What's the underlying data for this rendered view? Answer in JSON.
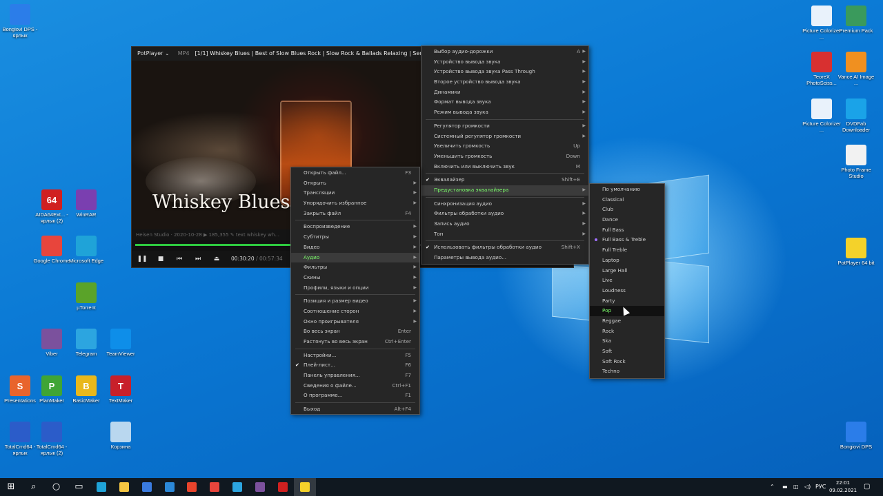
{
  "desktop": {
    "icons": [
      {
        "label": "Bongiovi DPS - ярлык",
        "icon": "bongiovi-icon",
        "color": "#2b7de9"
      },
      {
        "label": "AIDA64Ext... - ярлык (2)",
        "icon": "aida64-icon",
        "glyph": "64",
        "color": "#d02020"
      },
      {
        "label": "WinRAR",
        "icon": "winrar-icon",
        "color": "#7a3fb0"
      },
      {
        "label": "Google Chrome",
        "icon": "chrome-icon",
        "color": "#e8453c"
      },
      {
        "label": "Microsoft Edge",
        "icon": "edge-icon",
        "color": "#1fa3d8"
      },
      {
        "label": "µTorrent",
        "icon": "utorrent-icon",
        "color": "#5aa329"
      },
      {
        "label": "Viber",
        "icon": "viber-icon",
        "color": "#7b519d"
      },
      {
        "label": "Telegram",
        "icon": "telegram-icon",
        "color": "#2ca5e0"
      },
      {
        "label": "TeamViewer",
        "icon": "teamviewer-icon",
        "color": "#0e8ee9"
      },
      {
        "label": "Presentations",
        "icon": "presentations-icon",
        "glyph": "S",
        "color": "#e8642c"
      },
      {
        "label": "PlanMaker",
        "icon": "planmaker-icon",
        "glyph": "P",
        "color": "#3fa535"
      },
      {
        "label": "BasicMaker",
        "icon": "basicmaker-icon",
        "glyph": "B",
        "color": "#e9b81b"
      },
      {
        "label": "TextMaker",
        "icon": "textmaker-icon",
        "glyph": "T",
        "color": "#c8202a"
      },
      {
        "label": "TotalCmd64 - ярлык",
        "icon": "totalcmd-icon",
        "color": "#2b5cc9"
      },
      {
        "label": "TotalCmd64 - ярлык (2)",
        "icon": "totalcmd-icon",
        "color": "#2b5cc9"
      },
      {
        "label": "Корзина",
        "icon": "recycle-bin-icon",
        "color": "#b9d7ef"
      },
      {
        "label": "Picture Colorizer ...",
        "icon": "picture-colorizer-icon",
        "color": "#e9f2fb"
      },
      {
        "label": "Premium Pack",
        "icon": "premium-pack-icon",
        "color": "#3a9a5c"
      },
      {
        "label": "TeoreX PhotoSciss...",
        "icon": "photoscissors-icon",
        "color": "#d83030"
      },
      {
        "label": "Vance AI Image ...",
        "icon": "vanceai-icon",
        "color": "#f09020"
      },
      {
        "label": "Picture Colorizer ...",
        "icon": "picture-colorizer-icon",
        "color": "#e9f2fb"
      },
      {
        "label": "DVDFab Downloader",
        "icon": "dvdfab-icon",
        "color": "#1aa3e8"
      },
      {
        "label": "Photo Frame Studio",
        "icon": "photo-frame-icon",
        "color": "#f2f2f2"
      },
      {
        "label": "PotPlayer 64 bit",
        "icon": "potplayer-icon",
        "color": "#f4d22a"
      },
      {
        "label": "Bongiovi DPS",
        "icon": "bongiovi-icon",
        "color": "#2b7de9"
      }
    ]
  },
  "player": {
    "app_name": "PotPlayer ⌄",
    "format": "MP4",
    "title": "[1/1] Whiskey Blues | Best of Slow Blues Rock | Slow Rock & Ballads Relaxing | Sensu",
    "video_title_text": "Whiskey Blues",
    "meta_text": "Heisen Studio  ·  2020-10-28  ▶ 185,355  ✎ text whiskey wh...",
    "current_time": "00:30:20",
    "duration": "/ 00:57:34",
    "progress": 0.53
  },
  "context_menu": {
    "items": [
      {
        "label": "Открыть файл...",
        "shortcut": "F3"
      },
      {
        "label": "Открыть",
        "arrow": true
      },
      {
        "label": "Трансляции",
        "arrow": true
      },
      {
        "label": "Упорядочить избранное",
        "arrow": true
      },
      {
        "label": "Закрыть файл",
        "shortcut": "F4"
      },
      {
        "sep": true
      },
      {
        "label": "Воспроизведение",
        "arrow": true
      },
      {
        "label": "Субтитры",
        "arrow": true
      },
      {
        "label": "Видео",
        "arrow": true
      },
      {
        "label": "Аудио",
        "arrow": true,
        "highlight": true
      },
      {
        "label": "Фильтры",
        "arrow": true
      },
      {
        "label": "Скины",
        "arrow": true
      },
      {
        "label": "Профили, языки и опции",
        "arrow": true
      },
      {
        "sep": true
      },
      {
        "label": "Позиция и размер видео",
        "arrow": true
      },
      {
        "label": "Соотношение сторон",
        "arrow": true
      },
      {
        "label": "Окно проигрывателя",
        "arrow": true
      },
      {
        "label": "Во весь экран",
        "shortcut": "Enter"
      },
      {
        "label": "Растянуть во весь экран",
        "shortcut": "Ctrl+Enter"
      },
      {
        "sep": true
      },
      {
        "label": "Настройки...",
        "shortcut": "F5"
      },
      {
        "label": "Плей-лист...",
        "shortcut": "F6",
        "check": true
      },
      {
        "label": "Панель управления...",
        "shortcut": "F7"
      },
      {
        "label": "Сведения о файле...",
        "shortcut": "Ctrl+F1"
      },
      {
        "label": "О программе...",
        "shortcut": "F1"
      },
      {
        "sep": true
      },
      {
        "label": "Выход",
        "shortcut": "Alt+F4"
      }
    ]
  },
  "audio_menu": {
    "items": [
      {
        "label": "Выбор аудио-дорожки",
        "shortcut": "A",
        "arrow": true
      },
      {
        "label": "Устройство вывода звука",
        "arrow": true
      },
      {
        "label": "Устройство вывода звука Pass Through",
        "arrow": true
      },
      {
        "label": "Второе устройство вывода звука",
        "arrow": true
      },
      {
        "label": "Динамики",
        "arrow": true
      },
      {
        "label": "Формат вывода звука",
        "arrow": true
      },
      {
        "label": "Режим вывода звука",
        "arrow": true
      },
      {
        "sep": true
      },
      {
        "label": "Регулятор громкости",
        "arrow": true
      },
      {
        "label": "Системный регулятор громкости",
        "arrow": true
      },
      {
        "label": "Увеличить громкость",
        "shortcut": "Up"
      },
      {
        "label": "Уменьшить громкость",
        "shortcut": "Down"
      },
      {
        "label": "Включить или выключить звук",
        "shortcut": "M"
      },
      {
        "sep": true
      },
      {
        "label": "Эквалайзер",
        "shortcut": "Shift+E",
        "check": true
      },
      {
        "label": "Предустановка эквалайзера",
        "arrow": true,
        "highlight": true
      },
      {
        "sep": true
      },
      {
        "label": "Синхронизация аудио",
        "arrow": true
      },
      {
        "label": "Фильтры обработки аудио",
        "arrow": true
      },
      {
        "label": "Запись аудио",
        "arrow": true
      },
      {
        "label": "Тон",
        "arrow": true
      },
      {
        "sep": true
      },
      {
        "label": "Использовать фильтры обработки аудио",
        "shortcut": "Shift+X",
        "check": true
      },
      {
        "label": "Параметры вывода аудио..."
      }
    ]
  },
  "eq_menu": {
    "items": [
      {
        "label": "По умолчанию"
      },
      {
        "label": "Classical"
      },
      {
        "label": "Club"
      },
      {
        "label": "Dance"
      },
      {
        "label": "Full Bass"
      },
      {
        "label": "Full Bass & Treble",
        "dot": true
      },
      {
        "label": "Full Treble"
      },
      {
        "label": "Laptop"
      },
      {
        "label": "Large Hall"
      },
      {
        "label": "Live"
      },
      {
        "label": "Loudness"
      },
      {
        "label": "Party"
      },
      {
        "label": "Pop",
        "highlight": true
      },
      {
        "label": "Reggae"
      },
      {
        "label": "Rock"
      },
      {
        "label": "Ska"
      },
      {
        "label": "Soft"
      },
      {
        "label": "Soft Rock"
      },
      {
        "label": "Techno"
      }
    ]
  },
  "taskbar": {
    "items": [
      "start-icon",
      "search-icon",
      "cortana-icon",
      "task-view-icon",
      "edge-icon",
      "file-explorer-icon",
      "store-icon",
      "mail-icon",
      "office-icon",
      "chrome-icon",
      "telegram-icon",
      "viber-icon",
      "app-red-icon",
      "potplayer-icon"
    ],
    "lang": "РУС",
    "time": "22:01",
    "date": "09.02.2021"
  }
}
